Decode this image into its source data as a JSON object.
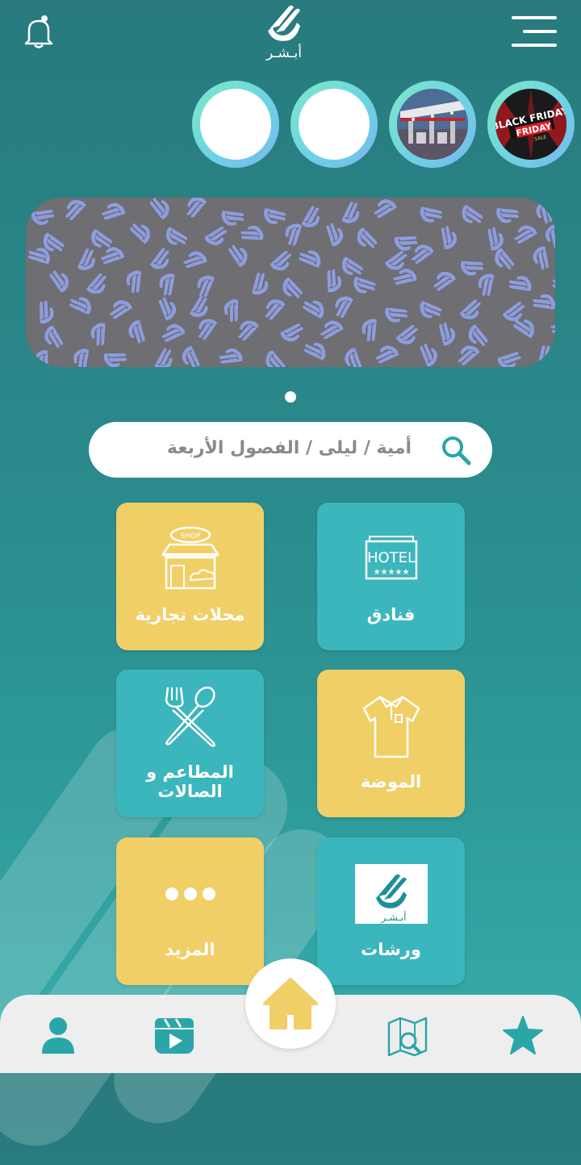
{
  "header": {
    "logo_text": "أبـشـر",
    "icons": {
      "left": "bell-icon",
      "right": "menu-icon"
    }
  },
  "stories": [
    {
      "label": "BLACK FRIDAY",
      "sub": "SALE",
      "image": "black-friday"
    },
    {
      "image": "gas-station"
    },
    {
      "image": "empty"
    },
    {
      "image": "empty"
    }
  ],
  "banner": {
    "pattern": "hand-logo-pattern",
    "dots": 1,
    "active_dot": 1
  },
  "search": {
    "placeholder": "أمية / ليلى / الفصول الأربعة"
  },
  "categories": [
    {
      "label": "فنادق",
      "icon": "hotel-icon",
      "icon_text": "HOTEL",
      "color": "#3bb6bc"
    },
    {
      "label": "محلات تجارية",
      "icon": "shop-icon",
      "icon_text": "SHOP",
      "color": "#f0cf66"
    },
    {
      "label": "الموضة",
      "icon": "shirt-icon",
      "color": "#f0cf66"
    },
    {
      "label": "المطاعم و الصالات",
      "icon": "restaurant-icon",
      "color": "#3bb6bc"
    },
    {
      "label": "ورشات",
      "icon": "app-logo-icon",
      "icon_text": "أبـشـر",
      "color": "#3bb6bc"
    },
    {
      "label": "المزيد",
      "icon": "more-dots-icon",
      "color": "#f0cf66"
    }
  ],
  "bottom_nav": {
    "items": [
      "profile-icon",
      "video-icon",
      "home-icon",
      "map-search-icon",
      "star-icon"
    ],
    "active": "home-icon"
  },
  "colors": {
    "teal": "#3bb6bc",
    "yellow": "#f0cf66",
    "background": "#2a8a8c",
    "nav_icon": "#2aa6a9"
  }
}
